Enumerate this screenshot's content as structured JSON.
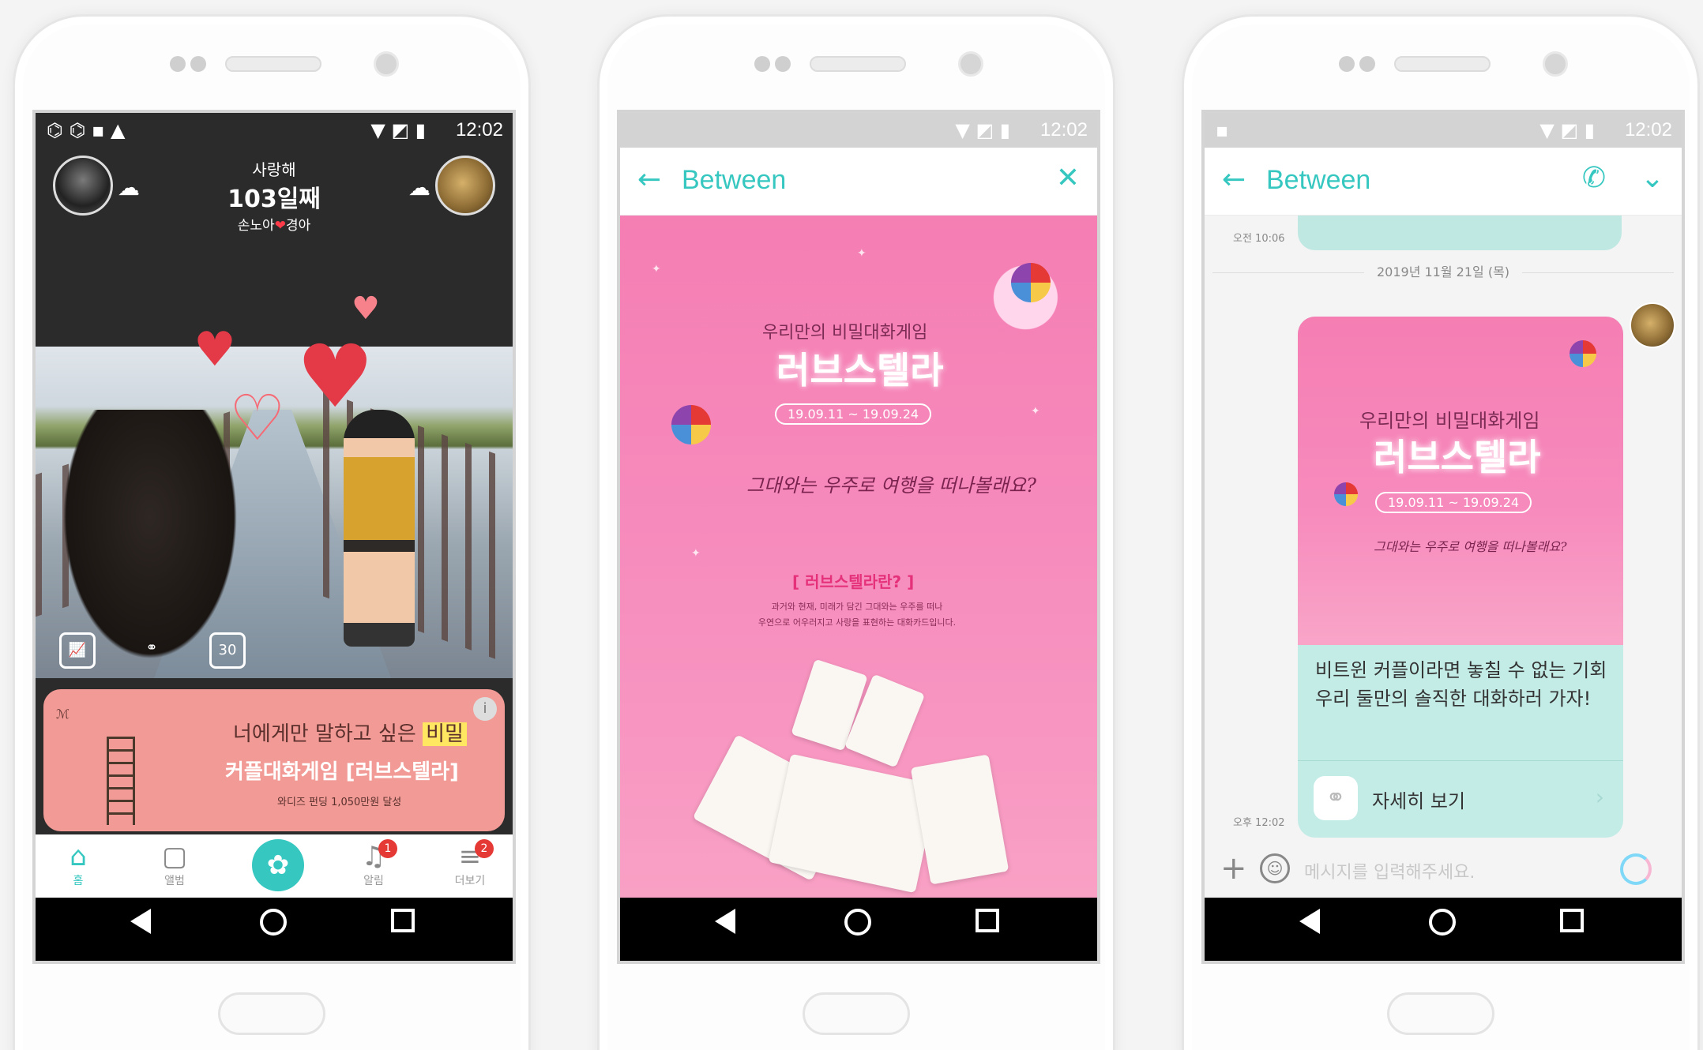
{
  "phones": [
    {
      "status_time": "12:02",
      "header": {
        "subtitle": "사랑해",
        "days": "103일째",
        "name_left": "손노아",
        "name_right": "경아",
        "heart": "❤"
      },
      "photo_tools": [
        "📈",
        "⚭",
        "30"
      ],
      "banner": {
        "logo": "ℳ",
        "line1_prefix": "너에게만 말하고 싶은 ",
        "line1_highlight": "비밀",
        "line2": "커플대화게임 [러브스텔라]",
        "line3": "와디즈 펀딩 1,050만원 달성",
        "info": "i"
      },
      "tabs": [
        {
          "label": "홈",
          "icon": "⌂",
          "badge": ""
        },
        {
          "label": "앨범",
          "icon": "▢",
          "badge": ""
        },
        {
          "label": "",
          "icon": "✿",
          "badge": ""
        },
        {
          "label": "알림",
          "icon": "♫",
          "badge": "1"
        },
        {
          "label": "더보기",
          "icon": "≡",
          "badge": "2"
        }
      ]
    },
    {
      "status_time": "12:02",
      "appbar": {
        "title": "Between",
        "back": "←",
        "close": "✕"
      },
      "poster": {
        "subtitle": "우리만의 비밀대화게임",
        "title": "러브스텔라",
        "date": "19.09.11 ~ 19.09.24",
        "script": "그대와는 우주로 여행을 떠나볼래요?",
        "question": "[ 러브스텔라란? ]",
        "desc1": "과거와 현재, 미래가 담긴 그대와는 우주를 떠나",
        "desc2": "우연으로 어우러지고 사랑을 표현하는 대화카드입니다."
      }
    },
    {
      "status_time": "12:02",
      "appbar": {
        "title": "Between",
        "back": "←",
        "call": "✆",
        "more": "⌄"
      },
      "chat": {
        "prev_time": "오전 10:06",
        "date_divider": "2019년 11월 21일 (목)",
        "card_subtitle": "우리만의 비밀대화게임",
        "card_title": "러브스텔라",
        "card_date": "19.09.11 ~ 19.09.24",
        "card_script": "그대와는 우주로 여행을 떠나볼래요?",
        "message": "비트윈 커플이라면 놓칠 수 없는 기회\n우리 둘만의 솔직한 대화하러 가자!",
        "link_label": "자세히 보기",
        "msg_time": "오후 12:02",
        "input_placeholder": "메시지를 입력해주세요."
      }
    }
  ],
  "colors": {
    "accent": "#35c7c0",
    "pink": "#f57eb3",
    "banner": "#f29b96",
    "bubble": "#c4ece7"
  }
}
